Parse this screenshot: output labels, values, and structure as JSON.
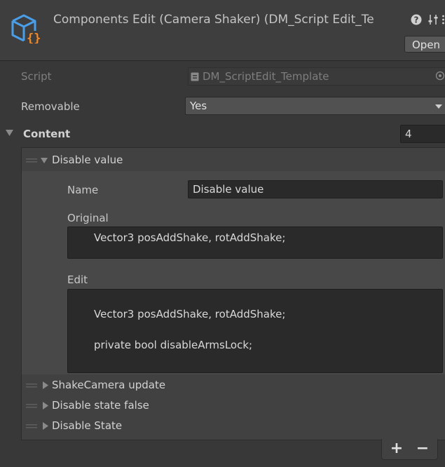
{
  "header": {
    "title": "Components Edit (Camera Shaker) (DM_Script Edit_Te",
    "open_label": "Open",
    "icon": "cube-script-icon",
    "help_icon": "help-icon",
    "settings_icon": "settings-sliders-icon",
    "more_icon": "more-vertical-icon"
  },
  "fields": {
    "script_label": "Script",
    "script_value": "DM_ScriptEdit_Template",
    "removable_label": "Removable",
    "removable_value": "Yes"
  },
  "content": {
    "label": "Content",
    "count": "4",
    "items": [
      {
        "label": "Disable value",
        "expanded": true,
        "name_label": "Name",
        "name_value": "Disable value",
        "original_label": "Original",
        "original_lines": [
          "Vector3 posAddShake, rotAddShake;"
        ],
        "edit_label": "Edit",
        "edit_lines": [
          "Vector3 posAddShake, rotAddShake;",
          "private bool disableArmsLock;"
        ]
      },
      {
        "label": "ShakeCamera update",
        "expanded": false
      },
      {
        "label": "Disable state false",
        "expanded": false
      },
      {
        "label": "Disable State",
        "expanded": false
      }
    ]
  },
  "footer": {
    "add_label": "+",
    "remove_label": "−"
  },
  "colors": {
    "background": "#383838",
    "header_bg": "#3e3e3e",
    "input_bg": "#2a2a2a",
    "icon_blue": "#4a9ee8",
    "icon_orange": "#f08a2c"
  }
}
